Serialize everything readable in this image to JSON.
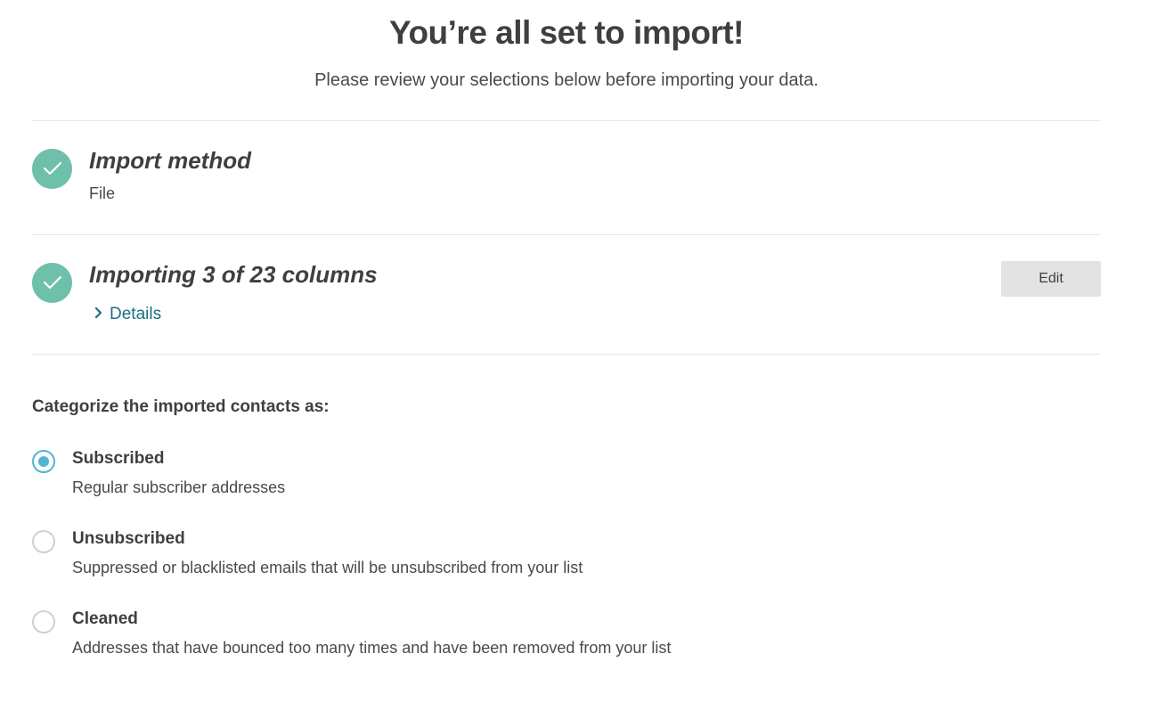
{
  "header": {
    "title": "You’re all set to import!",
    "subtitle": "Please review your selections below before importing your data."
  },
  "steps": [
    {
      "title": "Import method",
      "value": "File",
      "icon": "check-icon",
      "status": "complete"
    },
    {
      "title": "Importing 3 of 23 columns",
      "details_label": "Details",
      "edit_label": "Edit",
      "icon": "check-icon",
      "status": "complete"
    }
  ],
  "categorize": {
    "heading": "Categorize the imported contacts as:",
    "selected": "Subscribed",
    "options": [
      {
        "label": "Subscribed",
        "description": "Regular subscriber addresses",
        "checked": true
      },
      {
        "label": "Unsubscribed",
        "description": "Suppressed or blacklisted emails that will be unsubscribed from your list",
        "checked": false
      },
      {
        "label": "Cleaned",
        "description": "Addresses that have bounced too many times and have been removed from your list",
        "checked": false
      }
    ]
  },
  "colors": {
    "check_green": "#6ec0aa",
    "radio_blue": "#52b4d3",
    "link_teal": "#1d6f7c",
    "text_dark": "#403f3e",
    "button_gray": "#e3e3e3"
  }
}
